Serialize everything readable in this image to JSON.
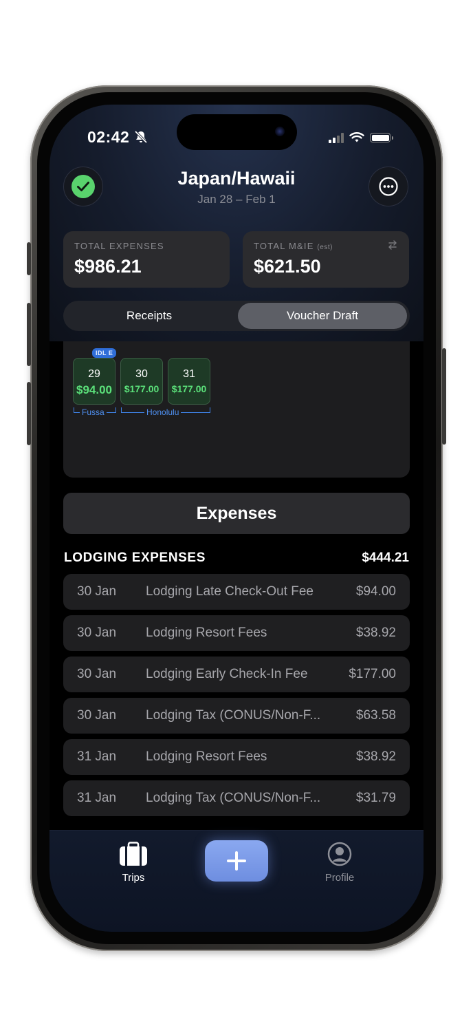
{
  "status": {
    "time": "02:42"
  },
  "trip": {
    "title": "Japan/Hawaii",
    "dates": "Jan 28 – Feb 1"
  },
  "stats": {
    "total_expenses_label": "TOTAL EXPENSES",
    "total_expenses_value": "$986.21",
    "total_mie_label": "TOTAL M&IE",
    "total_mie_suffix": "(est)",
    "total_mie_value": "$621.50"
  },
  "segment": {
    "receipts": "Receipts",
    "voucher": "Voucher Draft",
    "active": "Voucher Draft"
  },
  "calendar": {
    "badge": "IDL E",
    "days": [
      {
        "day": "29",
        "amount": "$94.00"
      },
      {
        "day": "30",
        "amount": "$177.00"
      },
      {
        "day": "31",
        "amount": "$177.00"
      }
    ],
    "locations": [
      "Fussa",
      "Honolulu"
    ]
  },
  "expenses": {
    "header": "Expenses",
    "section_title": "LODGING EXPENSES",
    "section_total": "$444.21",
    "rows": [
      {
        "date": "30 Jan",
        "desc": "Lodging Late Check-Out Fee",
        "amount": "$94.00"
      },
      {
        "date": "30 Jan",
        "desc": "Lodging Resort Fees",
        "amount": "$38.92"
      },
      {
        "date": "30 Jan",
        "desc": "Lodging Early Check-In Fee",
        "amount": "$177.00"
      },
      {
        "date": "30 Jan",
        "desc": "Lodging Tax (CONUS/Non-F...",
        "amount": "$63.58"
      },
      {
        "date": "31 Jan",
        "desc": "Lodging Resort Fees",
        "amount": "$38.92"
      },
      {
        "date": "31 Jan",
        "desc": "Lodging Tax (CONUS/Non-F...",
        "amount": "$31.79"
      }
    ]
  },
  "tabbar": {
    "trips": "Trips",
    "profile": "Profile"
  },
  "icons": {
    "status_ok": "check-circle-icon",
    "more": "ellipsis-circle-icon",
    "swap": "arrows-swap-icon",
    "trips": "suitcase-icon",
    "add": "plus-icon",
    "profile": "person-circle-icon"
  },
  "colors": {
    "accent": "#6e8ee0",
    "success": "#5be17a",
    "location": "#4e8fef"
  }
}
